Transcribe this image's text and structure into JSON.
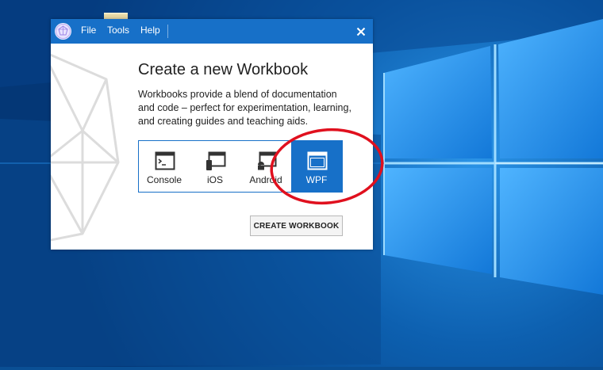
{
  "menu": {
    "items": [
      "File",
      "Tools",
      "Help"
    ]
  },
  "dialog": {
    "heading": "Create a new Workbook",
    "description": "Workbooks provide a blend of documentation and code – perfect for experimentation, learning, and creating guides and teaching aids.",
    "workbook_types": [
      {
        "label": "Console",
        "icon": "console-icon",
        "selected": false
      },
      {
        "label": "iOS",
        "icon": "ios-device-icon",
        "selected": false
      },
      {
        "label": "Android",
        "icon": "android-icon",
        "selected": false
      },
      {
        "label": "WPF",
        "icon": "wpf-window-icon",
        "selected": true
      }
    ],
    "create_button": "CREATE WORKBOOK"
  },
  "colors": {
    "accent": "#1770c8",
    "annotation": "#e0101e"
  }
}
